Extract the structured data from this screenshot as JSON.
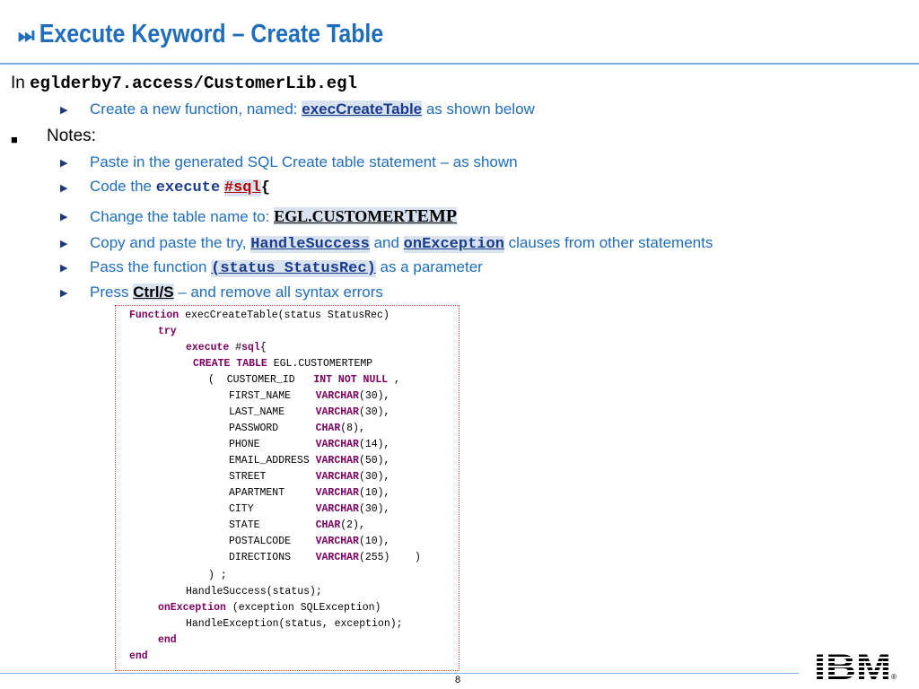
{
  "title": {
    "icon": "⏭",
    "text": "Execute Keyword – Create Table"
  },
  "intro": {
    "prefix": "In ",
    "path": "eglderby7.access/CustomerLib.egl"
  },
  "bullets": {
    "create": {
      "pre": "Create a new function, named: ",
      "name": "execCreateTable",
      "post": " as shown below"
    },
    "notes_label": "Notes:",
    "paste": "Paste in the generated SQL Create table statement – as shown",
    "code": {
      "pre": "Code the ",
      "kw": "execute",
      "sql": "#sql",
      "brace": "{"
    },
    "rename": {
      "pre": "Change the table name to:  ",
      "name_a": "EGL.CUSTOMER",
      "name_b": "TEMP"
    },
    "copy": {
      "pre": "Copy and paste the try, ",
      "h1": "HandleSuccess",
      "mid": " and ",
      "h2": "onException",
      "post": " clauses from other statements"
    },
    "pass": {
      "pre": "Pass the function ",
      "param": "(status StatusRec)",
      "post": " as a parameter"
    },
    "press": {
      "pre": "Press ",
      "key": "Ctrl/S",
      "post": " – and remove all syntax errors"
    }
  },
  "code": {
    "fn_kw": "Function",
    "fn_rest": " execCreateTable(status StatusRec)",
    "try": "try",
    "exec_kw": "execute",
    "exec_mid": " #",
    "exec_sql": "sql",
    "exec_brace": "{",
    "create_kw": "CREATE TABLE",
    "create_rest": " EGL.CUSTOMERTEMP",
    "cols": [
      {
        "pre": "(  CUSTOMER_ID   ",
        "type": "INT NOT NULL",
        "post": " ,"
      },
      {
        "pre": "FIRST_NAME    ",
        "type": "VARCHAR",
        "post": "(30),"
      },
      {
        "pre": "LAST_NAME     ",
        "type": "VARCHAR",
        "post": "(30),"
      },
      {
        "pre": "PASSWORD      ",
        "type": "CHAR",
        "post": "(8),"
      },
      {
        "pre": "PHONE         ",
        "type": "VARCHAR",
        "post": "(14),"
      },
      {
        "pre": "EMAIL_ADDRESS ",
        "type": "VARCHAR",
        "post": "(50),"
      },
      {
        "pre": "STREET        ",
        "type": "VARCHAR",
        "post": "(30),"
      },
      {
        "pre": "APARTMENT     ",
        "type": "VARCHAR",
        "post": "(10),"
      },
      {
        "pre": "CITY          ",
        "type": "VARCHAR",
        "post": "(30),"
      },
      {
        "pre": "STATE         ",
        "type": "CHAR",
        "post": "(2),"
      },
      {
        "pre": "POSTALCODE    ",
        "type": "VARCHAR",
        "post": "(10),"
      },
      {
        "pre": "DIRECTIONS    ",
        "type": "VARCHAR",
        "post": "(255)    )"
      }
    ],
    "close_paren": ") ;",
    "success": "HandleSuccess(status);",
    "onexc_kw": "onException",
    "onexc_rest": " (exception SQLException)",
    "handle_exc": "HandleException(status, exception);",
    "end1": "end",
    "end2": "end"
  },
  "footer": {
    "page": "8",
    "logo": "IBM",
    "reg": "®"
  }
}
